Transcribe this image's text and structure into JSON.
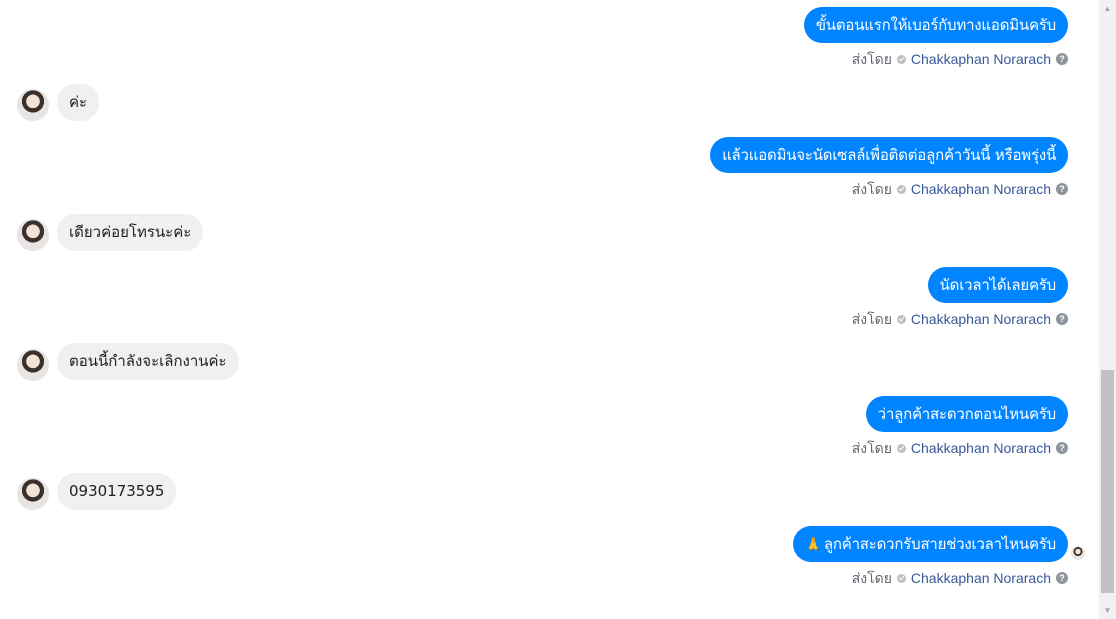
{
  "messages": [
    {
      "direction": "out",
      "text": "ขั้นตอนแรกให้เบอร์กับทางแอดมินครับ"
    },
    {
      "direction": "in",
      "text": "ค่ะ"
    },
    {
      "direction": "out",
      "text": "แล้วแอดมินจะนัดเซลล์เพื่อติดต่อลูกค้าวันนี้ หรือพรุ่งนี้"
    },
    {
      "direction": "in",
      "text": "เดียวค่อยโทรนะค่ะ"
    },
    {
      "direction": "out",
      "text": "นัดเวลาได้เลยครับ"
    },
    {
      "direction": "in",
      "text": "ตอนนี้กำลังจะเลิกงานค่ะ"
    },
    {
      "direction": "out",
      "text": "ว่าลูกค้าสะดวกตอนไหนครับ"
    },
    {
      "direction": "in",
      "text": "0930173595"
    },
    {
      "direction": "out",
      "emoji": "🙏",
      "text": "ลูกค้าสะดวกรับสายช่วงเวลาไหนครับ"
    }
  ],
  "sent_by": {
    "prefix": "ส่งโดย",
    "agent_name": "Chakkaphan Norarach",
    "help_glyph": "?"
  },
  "icons": {
    "verified": "check-circle-icon",
    "help": "question-circle-icon",
    "pray": "folded-hands-emoji"
  },
  "colors": {
    "outgoing_bubble": "#0084ff",
    "incoming_bubble": "#f1f0f0",
    "agent_name": "#385898"
  },
  "scrollbar": {
    "up_glyph": "▲",
    "down_glyph": "▼"
  }
}
